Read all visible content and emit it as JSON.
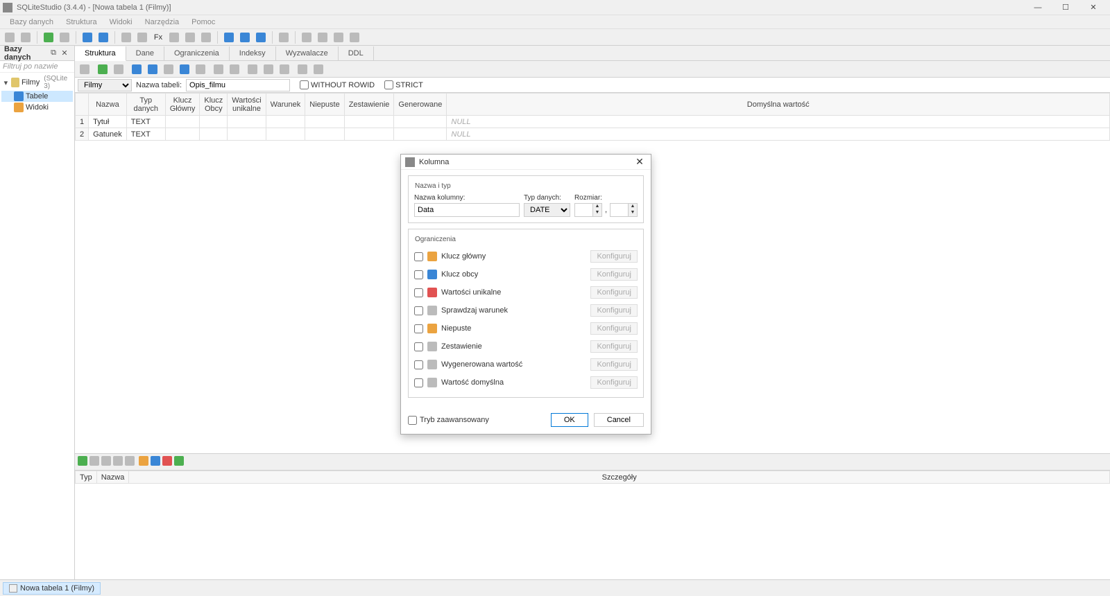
{
  "titlebar": {
    "text": "SQLiteStudio (3.4.4) - [Nowa tabela 1 (Filmy)]"
  },
  "menubar": [
    "Bazy danych",
    "Struktura",
    "Widoki",
    "Narzędzia",
    "Pomoc"
  ],
  "sidebar": {
    "header": "Bazy danych",
    "filter_placeholder": "Filtruj po nazwie",
    "db_name": "Filmy",
    "db_engine": "(SQLite 3)",
    "tables_label": "Tabele",
    "views_label": "Widoki"
  },
  "tabs": [
    "Struktura",
    "Dane",
    "Ograniczenia",
    "Indeksy",
    "Wyzwalacze",
    "DDL"
  ],
  "table_config": {
    "db_selector_value": "Filmy",
    "table_name_label": "Nazwa tabeli:",
    "table_name_value": "Opis_filmu",
    "without_rowid_label": "WITHOUT ROWID",
    "strict_label": "STRICT"
  },
  "columns_grid": {
    "headers": [
      "Nazwa",
      "Typ danych",
      "Klucz Główny",
      "Klucz Obcy",
      "Wartości unikalne",
      "Warunek",
      "Niepuste",
      "Zestawienie",
      "Generowane",
      "Domyślna wartość"
    ],
    "rows": [
      {
        "n": "1",
        "name": "Tytuł",
        "type": "TEXT",
        "default": "NULL"
      },
      {
        "n": "2",
        "name": "Gatunek",
        "type": "TEXT",
        "default": "NULL"
      }
    ]
  },
  "bottom_grid": {
    "headers": [
      "Typ",
      "Nazwa",
      "Szczegóły"
    ]
  },
  "dialog": {
    "title": "Kolumna",
    "section_name": "Nazwa i typ",
    "col_name_label": "Nazwa kolumny:",
    "col_name_value": "Data",
    "type_label": "Typ danych:",
    "type_value": "DATE",
    "size_label": "Rozmiar:",
    "size_sep": ",",
    "section_constraints": "Ograniczenia",
    "constraints": [
      "Klucz główny",
      "Klucz obcy",
      "Wartości unikalne",
      "Sprawdzaj warunek",
      "Niepuste",
      "Zestawienie",
      "Wygenerowana wartość",
      "Wartość domyślna"
    ],
    "configure_label": "Konfiguruj",
    "advanced_label": "Tryb zaawansowany",
    "ok_label": "OK",
    "cancel_label": "Cancel"
  },
  "statusbar": {
    "tab_label": "Nowa tabela 1 (Filmy)"
  }
}
